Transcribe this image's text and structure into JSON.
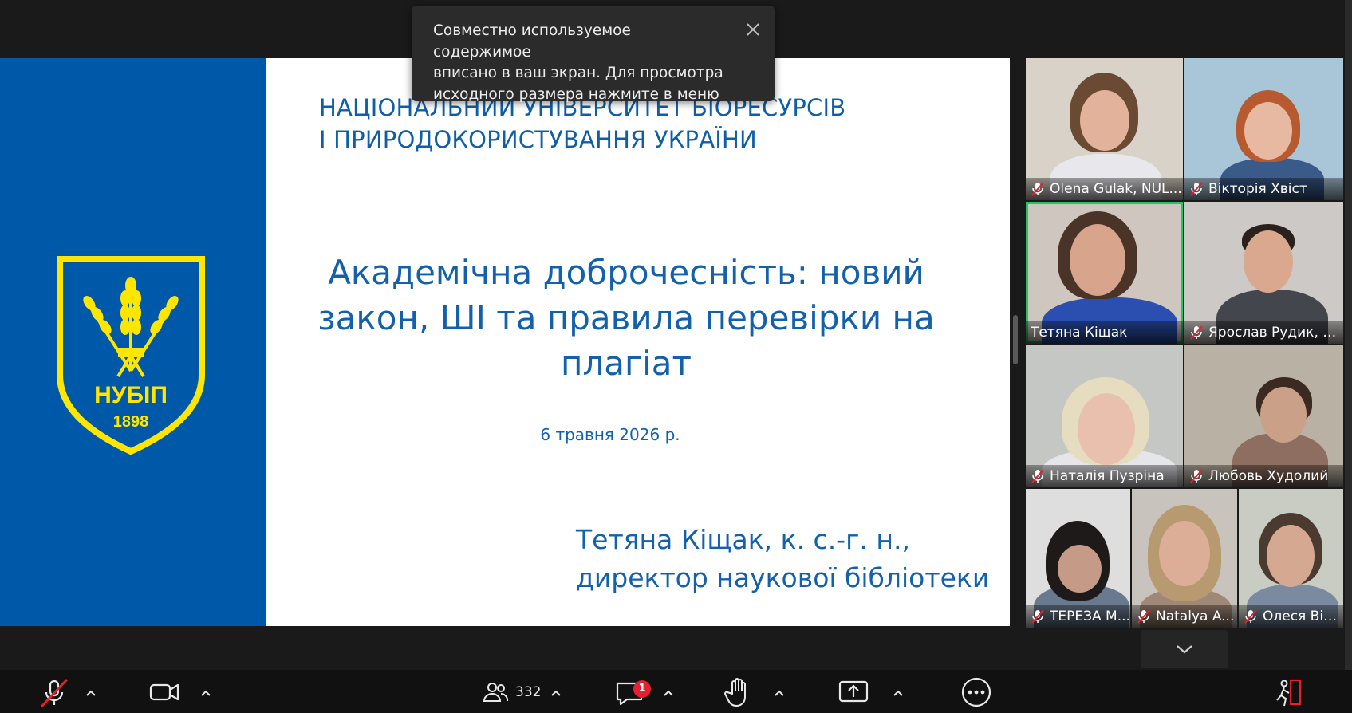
{
  "slide": {
    "university_line1": "НАЦІОНАЛЬНИЙ УНІВЕРСИТЕТ БІОРЕСУРСІВ",
    "university_line2": "І ПРИРОДОКОРИСТУВАННЯ УКРАЇНИ",
    "title_line1": "Академічна доброчесність: новий",
    "title_line2": "закон, ШІ та правила перевірки на",
    "title_line3": "плагіат",
    "date": "6 травня 2026 р.",
    "author_line1": "Тетяна Кіщак, к. с.-г. н.,",
    "author_line2": "директор наукової бібліотеки",
    "logo_text": "НУБІП",
    "logo_year": "1898",
    "brand_blue": "#0058a8",
    "logo_yellow": "#ffe600"
  },
  "toast": {
    "line1": "Совместно используемое содержимое",
    "line2": "вписано в ваш экран. Для просмотра",
    "line3": "исходного размера нажмите в меню"
  },
  "participants": [
    {
      "name": "Olena Gulak, NUL...",
      "muted": true
    },
    {
      "name": "Вікторія Хвіст",
      "muted": true
    },
    {
      "name": "Тетяна Кіщак",
      "muted": false,
      "speaking": true
    },
    {
      "name": "Ярослав Рудик, Н...",
      "muted": true
    },
    {
      "name": "Наталія Пузріна",
      "muted": true
    },
    {
      "name": "Любовь Худолий",
      "muted": true
    },
    {
      "name": "ТЕРЕЗА М...",
      "muted": true
    },
    {
      "name": "Natalya A...",
      "muted": true
    },
    {
      "name": "Олеся Віт...",
      "muted": true
    }
  ],
  "toolbar": {
    "participants_count": "332",
    "chat_badge": "1",
    "icons": [
      "mic-muted-icon",
      "camera-icon",
      "participants-icon",
      "chat-icon",
      "raise-hand-icon",
      "share-screen-icon",
      "more-icon",
      "leave-icon"
    ]
  },
  "colors": {
    "speaking_border": "#22c55e",
    "mute_red": "#e5202f"
  }
}
